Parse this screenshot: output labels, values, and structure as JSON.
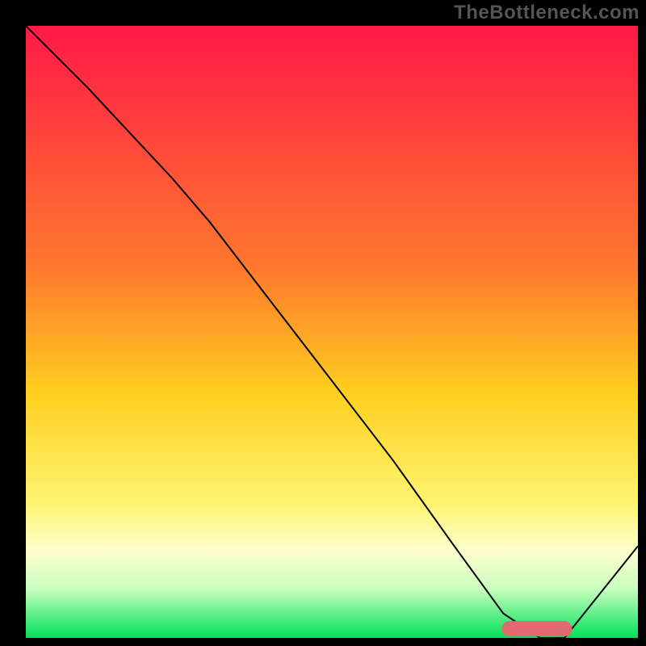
{
  "watermark": "TheBottleneck.com",
  "chart_data": {
    "type": "line",
    "title": "",
    "xlabel": "",
    "ylabel": "",
    "xlim": [
      0,
      100
    ],
    "ylim": [
      0,
      100
    ],
    "gradient_stops": [
      {
        "offset": 0,
        "color": "#ff1846"
      },
      {
        "offset": 40,
        "color": "#ff7a2e"
      },
      {
        "offset": 60,
        "color": "#ffcf1f"
      },
      {
        "offset": 78,
        "color": "#fff470"
      },
      {
        "offset": 86,
        "color": "#fdffcf"
      },
      {
        "offset": 92,
        "color": "#c8ffbe"
      },
      {
        "offset": 100,
        "color": "#00e05a"
      }
    ],
    "series": [
      {
        "name": "bottleneck-curve",
        "color": "#000000",
        "x": [
          0,
          10,
          24,
          30,
          40,
          50,
          60,
          70,
          78,
          84,
          88,
          100
        ],
        "y": [
          100,
          90,
          75,
          68,
          55,
          42,
          29,
          15,
          4,
          0,
          0,
          15
        ]
      }
    ],
    "marker": {
      "name": "optimal-range",
      "color": "#e06a6f",
      "x_start": 79,
      "x_end": 88,
      "y": 1.5,
      "thickness": 2.5
    }
  }
}
